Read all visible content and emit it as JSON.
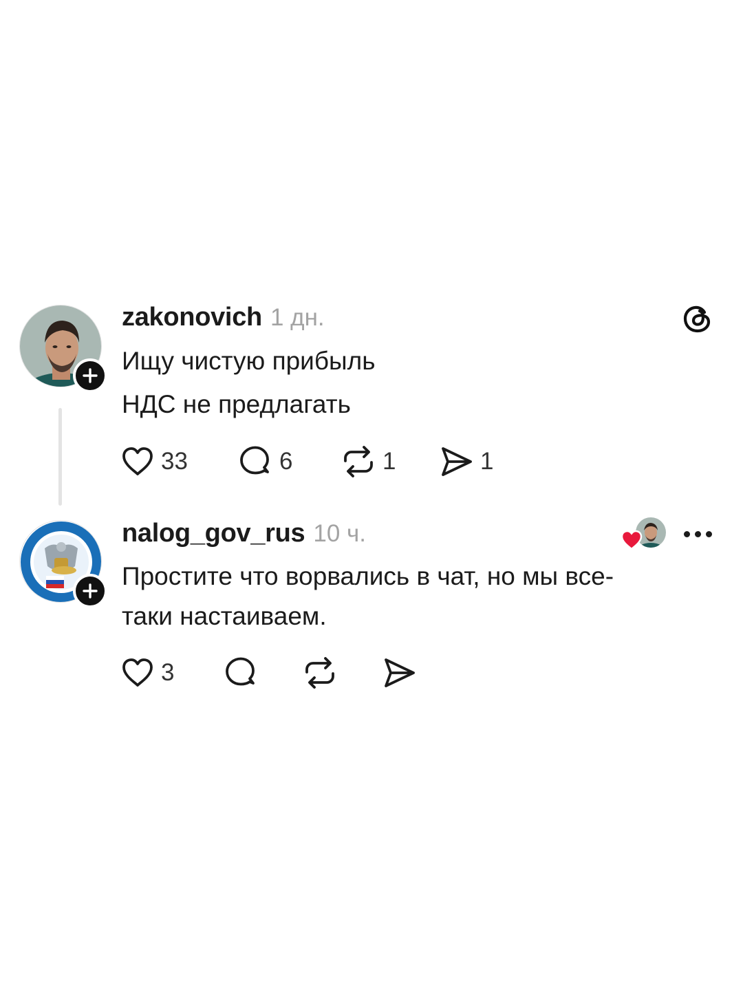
{
  "posts": [
    {
      "username": "zakonovich",
      "timestamp": "1 дн.",
      "lines": [
        "Ищу чистую прибыль",
        "НДС не предлагать"
      ],
      "likes": "33",
      "replies": "6",
      "reposts": "1",
      "shares": "1"
    },
    {
      "username": "nalog_gov_rus",
      "timestamp": "10 ч.",
      "lines": [
        "Простите что ворвались в чат, но мы все-",
        "таки настаиваем."
      ],
      "likes": "3"
    }
  ],
  "icons": {
    "app": "threads-logo-icon",
    "like": "heart-icon",
    "reply": "speech-bubble-icon",
    "repost": "repost-icon",
    "share": "paper-plane-icon",
    "follow": "plus-icon",
    "liked_by_author": "red-heart-icon",
    "more": "more-dots-icon"
  },
  "colors": {
    "text": "#1b1b1b",
    "muted": "#a3a3a3",
    "like_red": "#e8193c",
    "thread_line": "#e3e3e3"
  }
}
